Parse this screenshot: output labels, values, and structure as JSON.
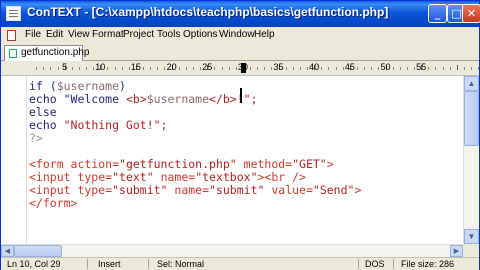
{
  "window": {
    "title": "ConTEXT - [C:\\xampp\\htdocs\\teachphp\\basics\\getfunction.php]"
  },
  "menubar": {
    "items": [
      "File",
      "Edit",
      "View",
      "Format",
      "Project",
      "Tools",
      "Options",
      "Window",
      "Help"
    ]
  },
  "tabs": [
    {
      "label": "getfunction.php",
      "active": true
    }
  ],
  "ruler": {
    "labels": [
      "5",
      "10",
      "15",
      "20",
      "25",
      "30",
      "35",
      "40",
      "45",
      "50",
      "55"
    ]
  },
  "editor": {
    "lines": [
      [
        "if (",
        "$username",
        ")"
      ],
      [
        "echo \"Welcome ",
        "<b>",
        "$username",
        "</b>",
        "!\";"
      ],
      [
        "else"
      ],
      [
        "echo ",
        "\"Nothing Got!\";"
      ],
      [
        "?>"
      ],
      [
        ""
      ],
      [
        "<form action=",
        "\"getfunction.php\"",
        " method=",
        "\"GET\"",
        ">"
      ],
      [
        "<input type=",
        "\"text\"",
        " name=",
        "\"textbox\"",
        "><br />"
      ],
      [
        "<input type=",
        "\"submit\"",
        " name=",
        "\"submit\"",
        " value=",
        "\"Send\"",
        ">"
      ],
      [
        "</form>"
      ]
    ]
  },
  "statusbar": {
    "position": "Ln 10, Col 29",
    "mode": "Insert",
    "selection": "Sel: Normal",
    "encoding": "DOS",
    "filesize": "File size: 286"
  },
  "colors": {
    "titlebar": "#0a5fdc",
    "chrome": "#ece9d8",
    "keyword": "#1f2a7a",
    "string": "#b22222",
    "tag": "#cc3a2a",
    "php_tag": "#9a9aa8"
  }
}
